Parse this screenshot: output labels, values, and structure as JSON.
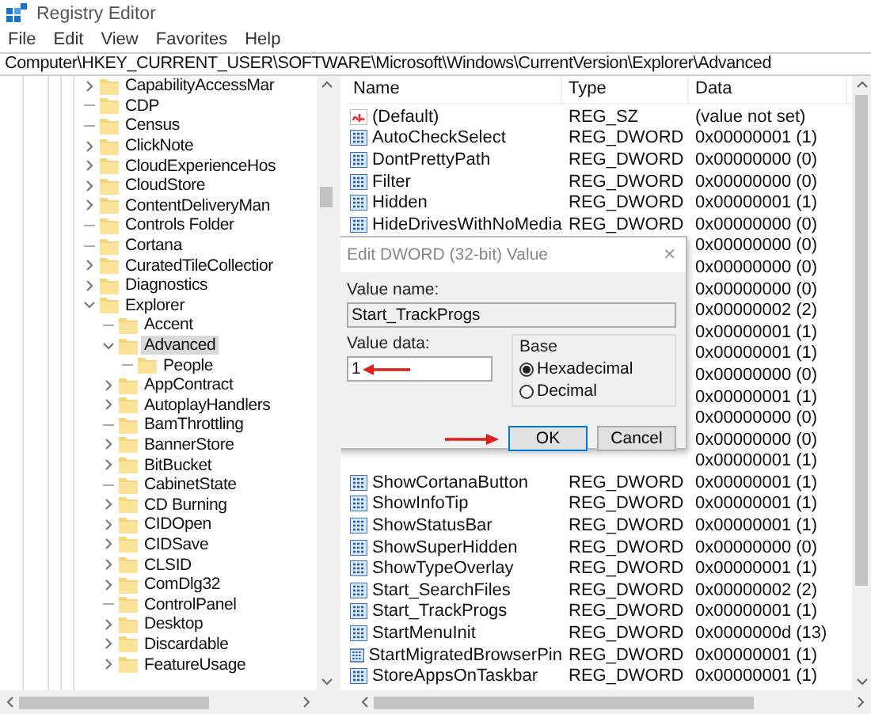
{
  "window": {
    "title": "Registry Editor"
  },
  "menu": [
    {
      "label": "File"
    },
    {
      "label": "Edit"
    },
    {
      "label": "View"
    },
    {
      "label": "Favorites"
    },
    {
      "label": "Help"
    }
  ],
  "address": "Computer\\HKEY_CURRENT_USER\\SOFTWARE\\Microsoft\\Windows\\CurrentVersion\\Explorer\\Advanced",
  "tree": [
    {
      "name": "CapabilityAccessMar",
      "kind": "branch",
      "expanded": false,
      "selected": false
    },
    {
      "name": "CDP",
      "kind": "leaf",
      "selected": false
    },
    {
      "name": "Census",
      "kind": "leaf",
      "selected": false
    },
    {
      "name": "ClickNote",
      "kind": "branch",
      "expanded": false,
      "selected": false
    },
    {
      "name": "CloudExperienceHos",
      "kind": "branch",
      "expanded": false,
      "selected": false
    },
    {
      "name": "CloudStore",
      "kind": "branch",
      "expanded": false,
      "selected": false
    },
    {
      "name": "ContentDeliveryMan",
      "kind": "branch",
      "expanded": false,
      "selected": false
    },
    {
      "name": "Controls Folder",
      "kind": "leaf",
      "selected": false
    },
    {
      "name": "Cortana",
      "kind": "leaf",
      "selected": false
    },
    {
      "name": "CuratedTileCollectior",
      "kind": "branch",
      "expanded": false,
      "selected": false
    },
    {
      "name": "Diagnostics",
      "kind": "branch",
      "expanded": false,
      "selected": false
    },
    {
      "name": "Explorer",
      "kind": "branch",
      "expanded": true,
      "selected": false,
      "children": [
        {
          "name": "Accent",
          "kind": "leaf",
          "selected": false
        },
        {
          "name": "Advanced",
          "kind": "branch",
          "expanded": true,
          "selected": true,
          "children": [
            {
              "name": "People",
              "kind": "leaf",
              "selected": false
            }
          ]
        },
        {
          "name": "AppContract",
          "kind": "branch",
          "expanded": false,
          "selected": false
        },
        {
          "name": "AutoplayHandlers",
          "kind": "branch",
          "expanded": false,
          "selected": false
        },
        {
          "name": "BamThrottling",
          "kind": "leaf",
          "selected": false
        },
        {
          "name": "BannerStore",
          "kind": "branch",
          "expanded": false,
          "selected": false
        },
        {
          "name": "BitBucket",
          "kind": "branch",
          "expanded": false,
          "selected": false
        },
        {
          "name": "CabinetState",
          "kind": "leaf",
          "selected": false
        },
        {
          "name": "CD Burning",
          "kind": "branch",
          "expanded": false,
          "selected": false
        },
        {
          "name": "CIDOpen",
          "kind": "branch",
          "expanded": false,
          "selected": false
        },
        {
          "name": "CIDSave",
          "kind": "branch",
          "expanded": false,
          "selected": false
        },
        {
          "name": "CLSID",
          "kind": "branch",
          "expanded": false,
          "selected": false
        },
        {
          "name": "ComDlg32",
          "kind": "branch",
          "expanded": false,
          "selected": false
        },
        {
          "name": "ControlPanel",
          "kind": "leaf",
          "selected": false
        },
        {
          "name": "Desktop",
          "kind": "branch",
          "expanded": false,
          "selected": false
        },
        {
          "name": "Discardable",
          "kind": "branch",
          "expanded": false,
          "selected": false
        },
        {
          "name": "FeatureUsage",
          "kind": "branch",
          "expanded": false,
          "selected": false
        }
      ]
    }
  ],
  "table": {
    "columns": [
      "Name",
      "Type",
      "Data"
    ],
    "rows": [
      {
        "kind": "string",
        "name": "(Default)",
        "type": "REG_SZ",
        "data": "(value not set)"
      },
      {
        "kind": "dword",
        "name": "AutoCheckSelect",
        "type": "REG_DWORD",
        "data": "0x00000001 (1)"
      },
      {
        "kind": "dword",
        "name": "DontPrettyPath",
        "type": "REG_DWORD",
        "data": "0x00000000 (0)"
      },
      {
        "kind": "dword",
        "name": "Filter",
        "type": "REG_DWORD",
        "data": "0x00000000 (0)"
      },
      {
        "kind": "dword",
        "name": "Hidden",
        "type": "REG_DWORD",
        "data": "0x00000001 (1)"
      },
      {
        "kind": "dword",
        "name": "HideDrivesWithNoMedia",
        "type": "REG_DWORD",
        "data": "0x00000000 (0)"
      },
      {
        "data": "0x00000000 (0)"
      },
      {
        "data": "0x00000000 (0)"
      },
      {
        "data": "0x00000000 (0)"
      },
      {
        "data": "0x00000002 (2)"
      },
      {
        "data": "0x00000001 (1)"
      },
      {
        "data": "0x00000001 (1)"
      },
      {
        "data": "0x00000000 (0)"
      },
      {
        "data": "0x00000001 (1)"
      },
      {
        "data": "0x00000000 (0)"
      },
      {
        "data": "0x00000000 (0)"
      },
      {
        "data": "0x00000001 (1)"
      },
      {
        "kind": "dword",
        "name": "ShowCortanaButton",
        "type": "REG_DWORD",
        "data": "0x00000001 (1)"
      },
      {
        "kind": "dword",
        "name": "ShowInfoTip",
        "type": "REG_DWORD",
        "data": "0x00000001 (1)"
      },
      {
        "kind": "dword",
        "name": "ShowStatusBar",
        "type": "REG_DWORD",
        "data": "0x00000001 (1)"
      },
      {
        "kind": "dword",
        "name": "ShowSuperHidden",
        "type": "REG_DWORD",
        "data": "0x00000000 (0)"
      },
      {
        "kind": "dword",
        "name": "ShowTypeOverlay",
        "type": "REG_DWORD",
        "data": "0x00000001 (1)"
      },
      {
        "kind": "dword",
        "name": "Start_SearchFiles",
        "type": "REG_DWORD",
        "data": "0x00000002 (2)"
      },
      {
        "kind": "dword",
        "name": "Start_TrackProgs",
        "type": "REG_DWORD",
        "data": "0x00000001 (1)"
      },
      {
        "kind": "dword",
        "name": "StartMenuInit",
        "type": "REG_DWORD",
        "data": "0x0000000d (13)"
      },
      {
        "kind": "dword",
        "name": "StartMigratedBrowserPin",
        "type": "REG_DWORD",
        "data": "0x00000001 (1)"
      },
      {
        "kind": "dword",
        "name": "StoreAppsOnTaskbar",
        "type": "REG_DWORD",
        "data": "0x00000001 (1)"
      }
    ]
  },
  "dialog": {
    "title": "Edit DWORD (32-bit) Value",
    "close": "✕",
    "value_name_label": "Value name:",
    "value_name": "Start_TrackProgs",
    "value_data_label": "Value data:",
    "value_data": "1",
    "base_label": "Base",
    "bases": [
      {
        "label": "Hexadecimal",
        "selected": true
      },
      {
        "label": "Decimal",
        "selected": false
      }
    ],
    "buttons": [
      {
        "label": "OK",
        "focused": true
      },
      {
        "label": "Cancel",
        "focused": false
      }
    ]
  }
}
